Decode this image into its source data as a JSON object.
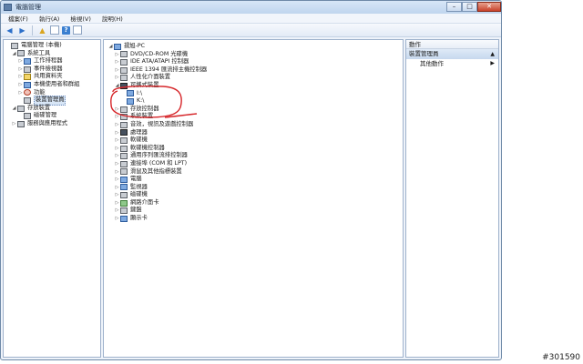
{
  "window": {
    "title": "電腦管理",
    "min": "–",
    "max": "□",
    "close": "✕"
  },
  "menu": [
    "檔案(F)",
    "執行(A)",
    "檢視(V)",
    "說明(H)"
  ],
  "left_tree": [
    {
      "label": "電腦管理 (本機)",
      "indent": 0,
      "exp": "",
      "icon": "gray"
    },
    {
      "label": "系統工具",
      "indent": 1,
      "exp": "◢",
      "icon": "gray"
    },
    {
      "label": "工作排程器",
      "indent": 2,
      "exp": "▷",
      "icon": "blue"
    },
    {
      "label": "事件檢視器",
      "indent": 2,
      "exp": "▷",
      "icon": "gray"
    },
    {
      "label": "共用資料夾",
      "indent": 2,
      "exp": "▷",
      "icon": "yellow"
    },
    {
      "label": "本機使用者和群組",
      "indent": 2,
      "exp": "▷",
      "icon": "blue"
    },
    {
      "label": "功能",
      "indent": 2,
      "exp": "▷",
      "icon": "red"
    },
    {
      "label": "裝置管理員",
      "indent": 2,
      "exp": "",
      "icon": "gray",
      "selected": true
    },
    {
      "label": "存放裝置",
      "indent": 1,
      "exp": "◢",
      "icon": "gray"
    },
    {
      "label": "磁碟管理",
      "indent": 2,
      "exp": "",
      "icon": "gray"
    },
    {
      "label": "服務與應用程式",
      "indent": 1,
      "exp": "▷",
      "icon": "gray"
    }
  ],
  "device_tree": [
    {
      "label": "揚旭-PC",
      "indent": 0,
      "exp": "◢",
      "icon": "blue"
    },
    {
      "label": "DVD/CD-ROM 光碟機",
      "indent": 1,
      "exp": "▷",
      "icon": "gray"
    },
    {
      "label": "IDE ATA/ATAPI 控制器",
      "indent": 1,
      "exp": "▷",
      "icon": "gray"
    },
    {
      "label": "IEEE 1394 匯流排主機控制器",
      "indent": 1,
      "exp": "▷",
      "icon": "gray"
    },
    {
      "label": "人性化介面裝置",
      "indent": 1,
      "exp": "▷",
      "icon": "gray"
    },
    {
      "label": "可攜式裝置",
      "indent": 1,
      "exp": "◢",
      "icon": "dark"
    },
    {
      "label": "I:\\",
      "indent": 2,
      "exp": "",
      "icon": "blue"
    },
    {
      "label": "K:\\",
      "indent": 2,
      "exp": "",
      "icon": "blue"
    },
    {
      "label": "存放控制器",
      "indent": 1,
      "exp": "▷",
      "icon": "gray"
    },
    {
      "label": "系統裝置",
      "indent": 1,
      "exp": "▷",
      "icon": "gray"
    },
    {
      "label": "音效，視訊及遊戲控制器",
      "indent": 1,
      "exp": "▷",
      "icon": "gray"
    },
    {
      "label": "處理器",
      "indent": 1,
      "exp": "▷",
      "icon": "dark"
    },
    {
      "label": "軟碟機",
      "indent": 1,
      "exp": "▷",
      "icon": "gray"
    },
    {
      "label": "軟碟機控制器",
      "indent": 1,
      "exp": "▷",
      "icon": "gray"
    },
    {
      "label": "通用序列匯流排控制器",
      "indent": 1,
      "exp": "▷",
      "icon": "gray"
    },
    {
      "label": "連接埠 (COM 和 LPT)",
      "indent": 1,
      "exp": "▷",
      "icon": "gray"
    },
    {
      "label": "滑鼠及其他指標裝置",
      "indent": 1,
      "exp": "▷",
      "icon": "gray"
    },
    {
      "label": "電腦",
      "indent": 1,
      "exp": "▷",
      "icon": "blue"
    },
    {
      "label": "監視器",
      "indent": 1,
      "exp": "▷",
      "icon": "blue"
    },
    {
      "label": "磁碟機",
      "indent": 1,
      "exp": "▷",
      "icon": "gray"
    },
    {
      "label": "網路介面卡",
      "indent": 1,
      "exp": "▷",
      "icon": "green"
    },
    {
      "label": "鍵盤",
      "indent": 1,
      "exp": "▷",
      "icon": "gray"
    },
    {
      "label": "顯示卡",
      "indent": 1,
      "exp": "▷",
      "icon": "blue"
    }
  ],
  "actions": {
    "title": "動作",
    "group": "裝置管理員",
    "item": "其他動作"
  },
  "watermark": "#301590",
  "colors": {
    "annotation": "#d6262a",
    "window_border": "#6f8aa8",
    "selection": "#d8e6f6"
  }
}
